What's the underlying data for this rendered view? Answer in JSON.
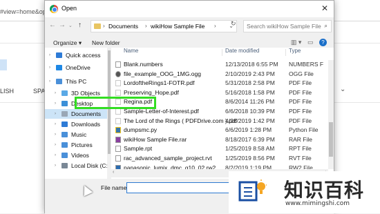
{
  "background": {
    "url_fragment": "#view=home&op",
    "lang_english": "LISH",
    "lang_spanish": "SPAN"
  },
  "dialog": {
    "title": "Open",
    "breadcrumb": [
      "Documents",
      "wikiHow Sample File"
    ],
    "search_placeholder": "Search wikiHow Sample File",
    "toolbar": {
      "organize": "Organize ▾",
      "new_folder": "New folder"
    },
    "sidebar": [
      {
        "label": "Quick access",
        "icon": "star-icon",
        "color": "#2e7bd6"
      },
      {
        "label": "OneDrive",
        "icon": "cloud-icon",
        "color": "#1e88e5"
      },
      {
        "label": "This PC",
        "icon": "computer-icon",
        "color": "#4a90d9"
      },
      {
        "label": "3D Objects",
        "icon": "cube-icon",
        "color": "#5aa9e6"
      },
      {
        "label": "Desktop",
        "icon": "desktop-icon",
        "color": "#3b8fd8"
      },
      {
        "label": "Documents",
        "icon": "documents-icon",
        "color": "#9aa7b5"
      },
      {
        "label": "Downloads",
        "icon": "download-icon",
        "color": "#2e7bd6"
      },
      {
        "label": "Music",
        "icon": "music-icon",
        "color": "#4a90d9"
      },
      {
        "label": "Pictures",
        "icon": "pictures-icon",
        "color": "#4a90d9"
      },
      {
        "label": "Videos",
        "icon": "videos-icon",
        "color": "#4a90d9"
      },
      {
        "label": "Local Disk (C:)",
        "icon": "disk-icon",
        "color": "#7a8896"
      }
    ],
    "columns": {
      "name": "Name",
      "date": "Date modified",
      "type": "Type"
    },
    "files": [
      {
        "name": "Blank.numbers",
        "date": "12/13/2018 6:55 PM",
        "type": "NUMBERS F"
      },
      {
        "name": "file_example_OOG_1MG.ogg",
        "date": "2/10/2019 2:43 PM",
        "type": "OGG File"
      },
      {
        "name": "LordoftheRings1-FOTR.pdf",
        "date": "5/31/2018 2:58 PM",
        "type": "PDF File"
      },
      {
        "name": "Preserving_Hope.pdf",
        "date": "5/16/2018 1:58 PM",
        "type": "PDF File"
      },
      {
        "name": "Regina.pdf",
        "date": "8/6/2014 11:26 PM",
        "type": "PDF File"
      },
      {
        "name": "Sample-Letter-of-Interest.pdf",
        "date": "6/6/2018 10:39 PM",
        "type": "PDF File"
      },
      {
        "name": "The Lord of the Rings ( PDFDrive.com ).pdf",
        "date": "4/26/2019 1:42 PM",
        "type": "PDF File"
      },
      {
        "name": "dumpsmc.py",
        "date": "6/6/2019 1:28 PM",
        "type": "Python File"
      },
      {
        "name": "wikiHow Sample File.rar",
        "date": "8/18/2017 6:39 PM",
        "type": "RAR File"
      },
      {
        "name": "Sample.rpt",
        "date": "1/25/2019 8:58 AM",
        "type": "RPT File"
      },
      {
        "name": "rac_advanced_sample_project.rvt",
        "date": "1/25/2019 8:56 PM",
        "type": "RVT File"
      },
      {
        "name": "panasonic_lumix_dmc_g10_02.rw2",
        "date": "8/2/2019 1:19 PM",
        "type": "RW2 File"
      }
    ],
    "file_name_label": "File name:",
    "file_name_value": ""
  },
  "watermark": {
    "cn_text": "知识百科",
    "url": "www.mimingshi.com"
  },
  "colors": {
    "highlight": "#33dd22",
    "accent": "#2b79d1"
  }
}
